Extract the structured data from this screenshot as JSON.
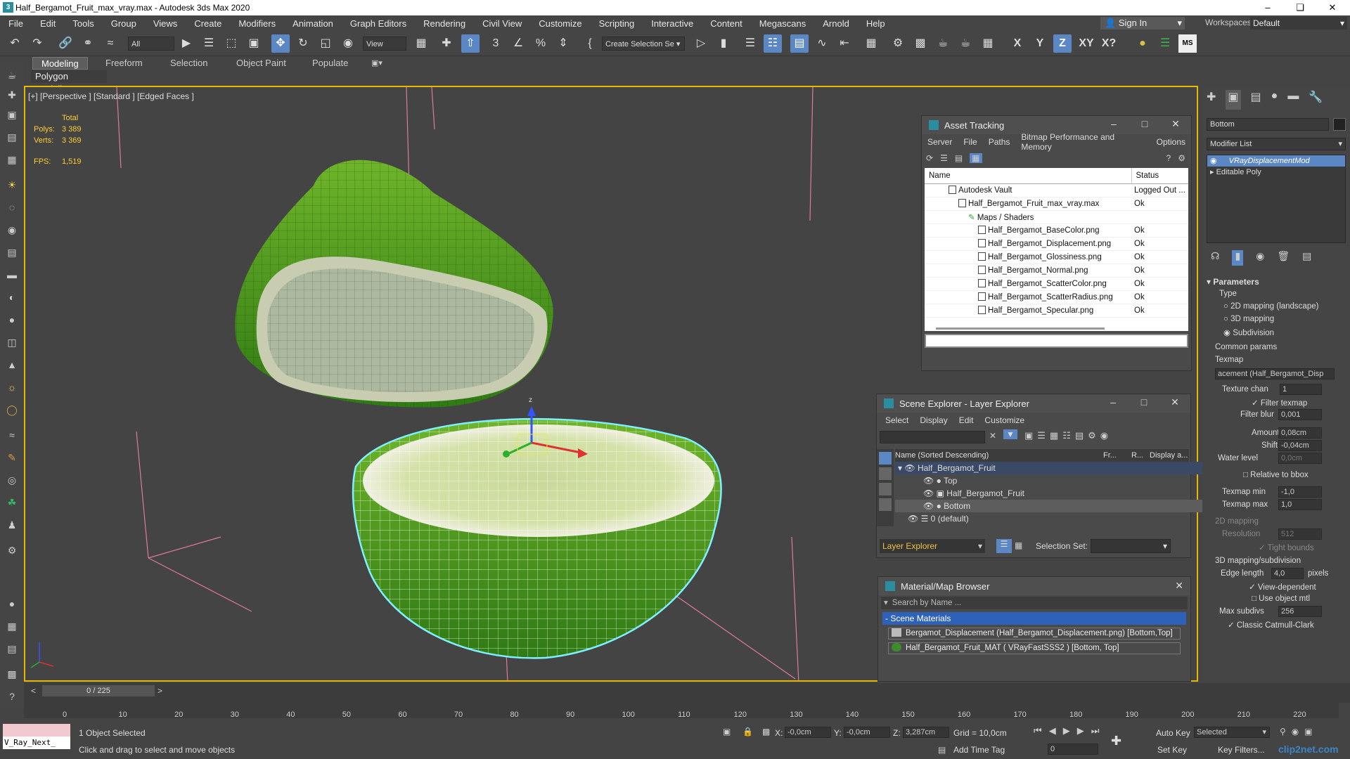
{
  "window": {
    "title": "Half_Bergamot_Fruit_max_vray.max - Autodesk 3ds Max 2020"
  },
  "menu": [
    "File",
    "Edit",
    "Tools",
    "Group",
    "Views",
    "Create",
    "Modifiers",
    "Animation",
    "Graph Editors",
    "Rendering",
    "Civil View",
    "Customize",
    "Scripting",
    "Interactive",
    "Content",
    "Megascans",
    "Arnold",
    "Help"
  ],
  "signin": "Sign In",
  "workspace": {
    "label": "Workspaces:",
    "value": "Default"
  },
  "toolbar": {
    "filter": "All",
    "refcoord": "View",
    "selection_set": "Create Selection Se",
    "axis_x": "X",
    "axis_y": "Y",
    "axis_z": "Z",
    "axis_xy": "XY",
    "axis_xq": "X?"
  },
  "ribbon": {
    "tabs": [
      "Modeling",
      "Freeform",
      "Selection",
      "Object Paint",
      "Populate"
    ],
    "sub": "Polygon Modeling"
  },
  "viewport": {
    "label": "[+] [Perspective ] [Standard ] [Edged Faces ]",
    "stats_total": "Total",
    "polys_label": "Polys:",
    "polys": "3 389",
    "verts_label": "Verts:",
    "verts": "3 369",
    "fps_label": "FPS:",
    "fps": "1,519",
    "gizmo_z": "z"
  },
  "asset_tracking": {
    "title": "Asset Tracking",
    "menu": [
      "Server",
      "File",
      "Paths",
      "Bitmap Performance and Memory",
      "Options"
    ],
    "col_name": "Name",
    "col_status": "Status",
    "rows": [
      {
        "name": "Autodesk Vault",
        "status": "Logged Out ..."
      },
      {
        "name": "Half_Bergamot_Fruit_max_vray.max",
        "status": "Ok"
      },
      {
        "name": "Maps / Shaders",
        "status": ""
      },
      {
        "name": "Half_Bergamot_BaseColor.png",
        "status": "Ok"
      },
      {
        "name": "Half_Bergamot_Displacement.png",
        "status": "Ok"
      },
      {
        "name": "Half_Bergamot_Glossiness.png",
        "status": "Ok"
      },
      {
        "name": "Half_Bergamot_Normal.png",
        "status": "Ok"
      },
      {
        "name": "Half_Bergamot_ScatterColor.png",
        "status": "Ok"
      },
      {
        "name": "Half_Bergamot_ScatterRadius.png",
        "status": "Ok"
      },
      {
        "name": "Half_Bergamot_Specular.png",
        "status": "Ok"
      }
    ]
  },
  "scene_explorer": {
    "title": "Scene Explorer - Layer Explorer",
    "menu": [
      "Select",
      "Display",
      "Edit",
      "Customize"
    ],
    "col_name": "Name (Sorted Descending)",
    "col_fr": "Fr...",
    "col_r": "R...",
    "col_disp": "Display a...",
    "rows": [
      "Half_Bergamot_Fruit",
      "Top",
      "Half_Bergamot_Fruit",
      "Bottom",
      "0 (default)"
    ],
    "layer_explorer": "Layer Explorer",
    "selection_set_label": "Selection Set:"
  },
  "material_browser": {
    "title": "Material/Map Browser",
    "search_placeholder": "Search by Name ...",
    "section": "- Scene Materials",
    "items": [
      "Bergamot_Displacement (Half_Bergamot_Displacement.png) [Bottom,Top]",
      "Half_Bergamot_Fruit_MAT ( VRayFastSSS2 ) [Bottom, Top]"
    ]
  },
  "command_panel": {
    "object_name": "Bottom",
    "modifier_list": "Modifier List",
    "stack": [
      "VRayDisplacementMod",
      "Editable Poly"
    ],
    "rollout": "Parameters",
    "type_label": "Type",
    "type_options": [
      "2D mapping (landscape)",
      "3D mapping",
      "Subdivision"
    ],
    "common_params": "Common params",
    "texmap_label": "Texmap",
    "texmap_value": "acement (Half_Bergamot_Disp",
    "texture_chan_label": "Texture chan",
    "texture_chan": "1",
    "filter_texmap": "Filter texmap",
    "filter_blur_label": "Filter blur",
    "filter_blur": "0,001",
    "amount_label": "Amount",
    "amount": "0,08cm",
    "shift_label": "Shift",
    "shift": "-0,04cm",
    "water_label": "Water level",
    "water": "0,0cm",
    "relative_bbox": "Relative to bbox",
    "texmap_min_label": "Texmap min",
    "texmap_min": "-1,0",
    "texmap_max_label": "Texmap max",
    "texmap_max": "1,0",
    "map2d_label": "2D mapping",
    "resolution_label": "Resolution",
    "resolution": "512",
    "tight_bounds": "Tight bounds",
    "map3d_label": "3D mapping/subdivision",
    "edge_length_label": "Edge length",
    "edge_length": "4,0",
    "pixels": "pixels",
    "view_dependent": "View-dependent",
    "use_object_mtl": "Use object mtl",
    "max_subdivs_label": "Max subdivs",
    "max_subdivs": "256",
    "classic_cc": "Classic Catmull-Clark"
  },
  "timeline": {
    "frame": "0 / 225",
    "ticks": [
      "0",
      "10",
      "20",
      "30",
      "40",
      "50",
      "60",
      "70",
      "80",
      "90",
      "100",
      "110",
      "120",
      "130",
      "140",
      "150",
      "160",
      "170",
      "180",
      "190",
      "200",
      "210",
      "220"
    ]
  },
  "status": {
    "maxscript": "V_Ray_Next_",
    "selected": "1 Object Selected",
    "hint": "Click and drag to select and move objects",
    "x_label": "X:",
    "x": "-0,0cm",
    "y_label": "Y:",
    "y": "-0,0cm",
    "z_label": "Z:",
    "z": "3,287cm",
    "grid": "Grid = 10,0cm",
    "add_time_tag": "Add Time Tag",
    "auto_key": "Auto Key",
    "set_key": "Set Key",
    "key_mode": "Selected",
    "key_filters": "Key Filters...",
    "frame_field": "0"
  },
  "watermark": "clip2net.com",
  "colors": {
    "accent": "#5b87c4",
    "viewport_border": "#e6b800",
    "stats": "#ffcc33",
    "selection_outline": "#7ff0ff"
  }
}
